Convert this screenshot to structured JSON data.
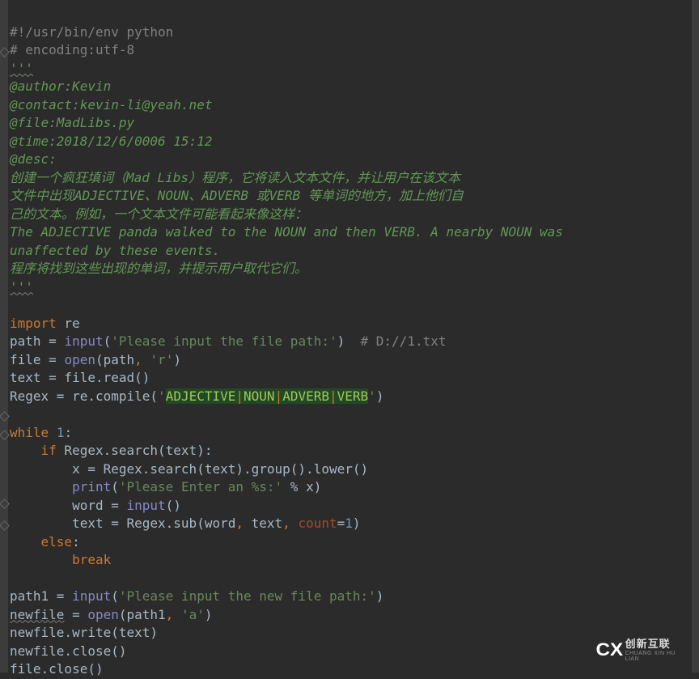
{
  "lines": {
    "l1": "#!/usr/bin/env python",
    "l2": "# encoding:utf-8",
    "l3": "'''",
    "l4": "@author:Kevin",
    "l5": "@contact:kevin-li@yeah.net",
    "l6": "@file:MadLibs.py",
    "l7": "@time:2018/12/6/0006 15:12",
    "l8": "@desc:",
    "l9": "创建一个疯狂填词（Mad Libs）程序，它将读入文本文件，并让用户在该文本",
    "l10": "文件中出现ADJECTIVE、NOUN、ADVERB 或VERB 等单词的地方，加上他们自",
    "l11": "己的文本。例如，一个文本文件可能看起来像这样：",
    "l12": "The ADJECTIVE panda walked to the NOUN and then VERB. A nearby NOUN was",
    "l13": "unaffected by these events.",
    "l14": "程序将找到这些出现的单词，并提示用户取代它们。",
    "l15": "'''",
    "l16_kw": "import",
    "l16_rest": " re",
    "l17_a": "path = ",
    "l17_builtin": "input",
    "l17_b": "(",
    "l17_str": "'Please input the file path:'",
    "l17_c": ")  ",
    "l17_cmt": "# D://1.txt",
    "l18_a": "file = ",
    "l18_builtin": "open",
    "l18_b": "(path",
    "l18_comma": ",",
    "l18_sp": " ",
    "l18_str": "'r'",
    "l18_c": ")",
    "l19": "text = file.read()",
    "l20_a": "Regex = re.",
    "l20_call": "compile",
    "l20_b": "(",
    "l20_sq": "'",
    "l20_h1": "ADJECTIVE",
    "l20_p1": "|",
    "l20_h2": "NOUN",
    "l20_p2": "|",
    "l20_h3": "ADVERB",
    "l20_p3": "|",
    "l20_h4": "VERB",
    "l20_sq2": "'",
    "l20_c": ")",
    "l22_kw": "while",
    "l22_sp": " ",
    "l22_n": "1",
    "l22_c": ":",
    "l23_indent": "    ",
    "l23_kw": "if",
    "l23_rest": " Regex.search(text):",
    "l24": "        x = Regex.search(text).group().lower()",
    "l25_indent": "        ",
    "l25_builtin": "print",
    "l25_a": "(",
    "l25_str": "'Please Enter an %s:'",
    "l25_b": " % x)",
    "l26_indent": "        ",
    "l26_a": "word = ",
    "l26_builtin": "input",
    "l26_b": "()",
    "l27_indent": "        ",
    "l27_a": "text = Regex.sub(word",
    "l27_c1": ",",
    "l27_s1": " text",
    "l27_c2": ",",
    "l27_s2": " ",
    "l27_kwarg": "count",
    "l27_eq": "=",
    "l27_n": "1",
    "l27_b": ")",
    "l28_indent": "    ",
    "l28_kw": "else",
    "l28_c": ":",
    "l29_indent": "        ",
    "l29_kw": "break",
    "l31_a": "path1 = ",
    "l31_builtin": "input",
    "l31_b": "(",
    "l31_str": "'Please input the new file path:'",
    "l31_c": ")",
    "l32_a": "newfile",
    "l32_b": " = ",
    "l32_builtin": "open",
    "l32_c": "(path1",
    "l32_comma": ",",
    "l32_sp": " ",
    "l32_str": "'a'",
    "l32_d": ")",
    "l33": "newfile.write(text)",
    "l34": "newfile.close()",
    "l35": "file.close()"
  },
  "logo": {
    "brand": "CX",
    "cn": "创新互联",
    "en": "CHUANG XIN HU LIAN"
  }
}
